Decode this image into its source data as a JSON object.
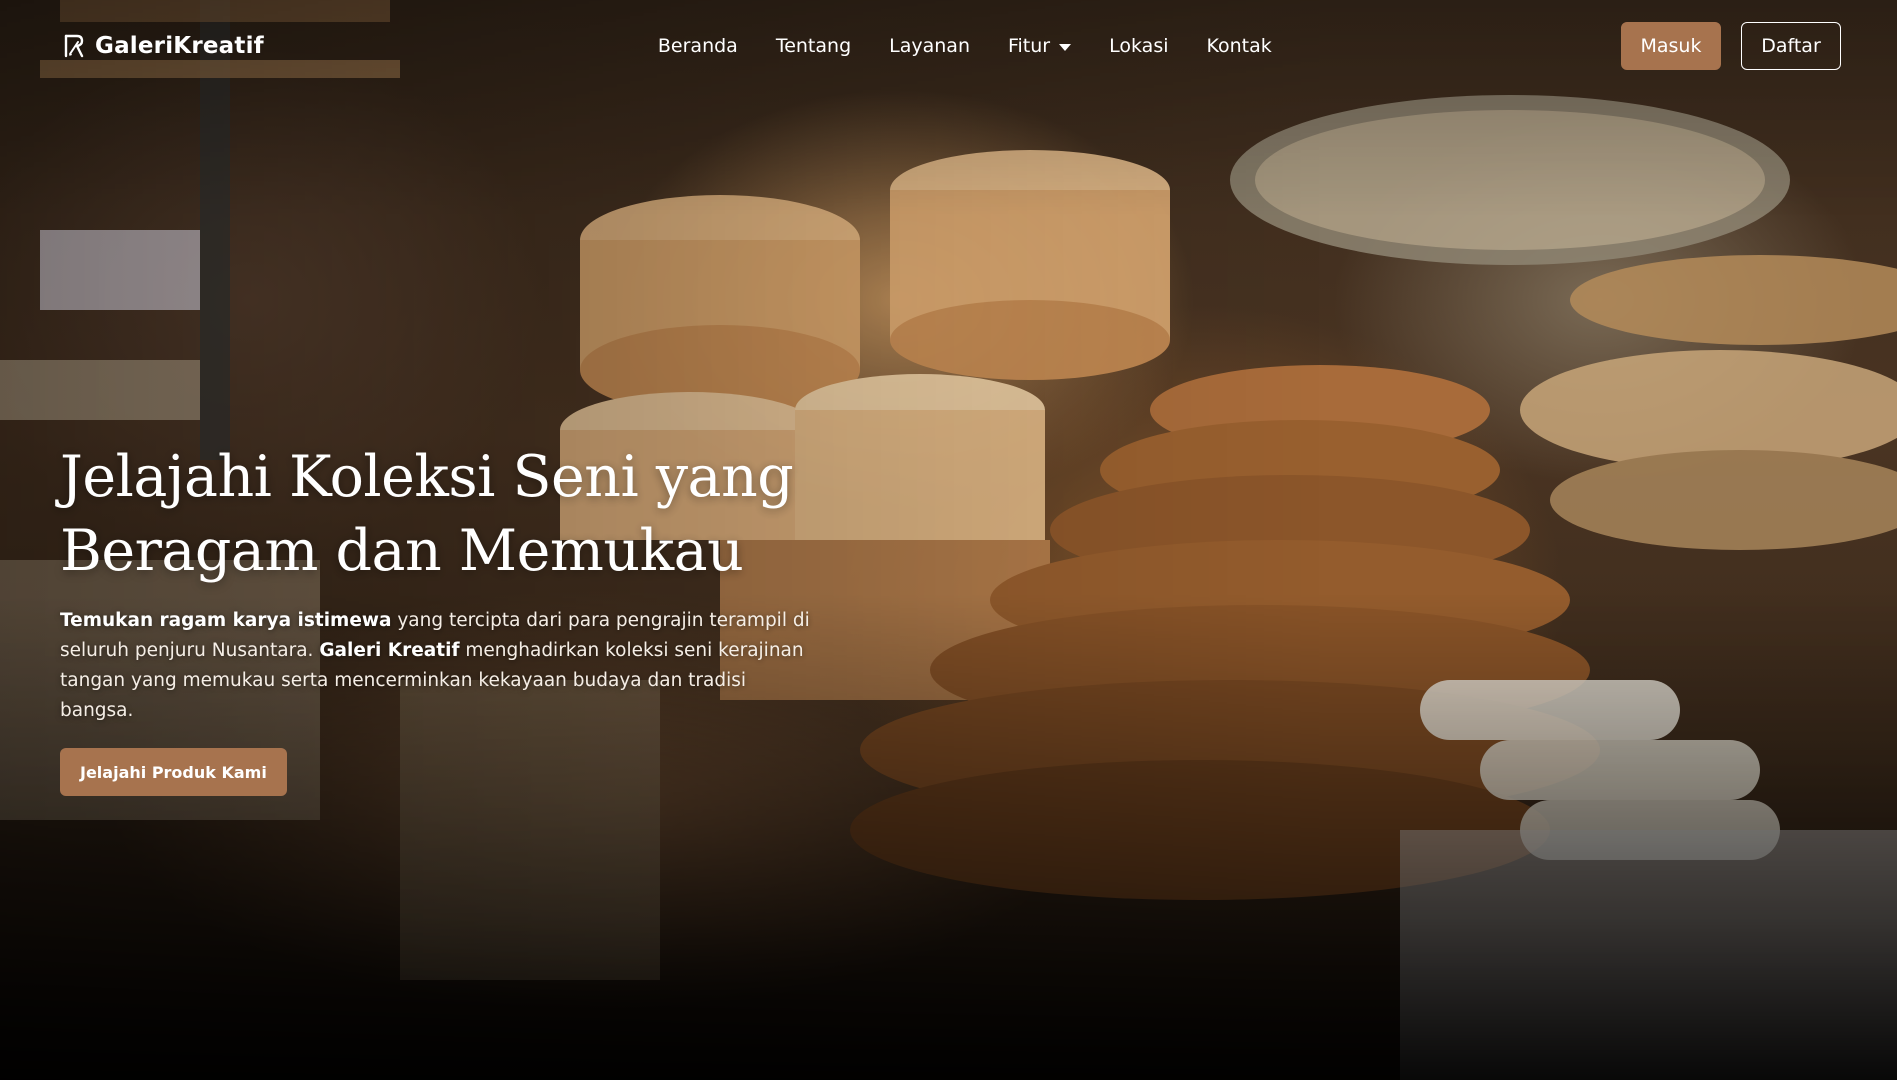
{
  "brand": {
    "name": "GaleriKreatif",
    "icon": "brush-logo-icon"
  },
  "nav": {
    "links": [
      {
        "label": "Beranda"
      },
      {
        "label": "Tentang"
      },
      {
        "label": "Layanan"
      },
      {
        "label": "Fitur",
        "icon": "caret-down-icon"
      },
      {
        "label": "Lokasi"
      },
      {
        "label": "Kontak"
      }
    ],
    "login_label": "Masuk",
    "register_label": "Daftar"
  },
  "hero": {
    "title_line1": "Jelajahi Koleksi Seni yang",
    "title_line2": "Beragam dan Memukau",
    "desc_strong1": "Temukan ragam karya istimewa",
    "desc_part1": " yang tercipta dari para pengrajin terampil di seluruh penjuru Nusantara. ",
    "desc_strong2": "Galeri Kreatif",
    "desc_part2": " menghadirkan koleksi seni kerajinan tangan yang memukau serta mencerminkan kekayaan budaya dan tradisi bangsa.",
    "cta_label": "Jelajahi Produk Kami"
  },
  "colors": {
    "accent": "#a7734e",
    "text": "#ffffff"
  }
}
